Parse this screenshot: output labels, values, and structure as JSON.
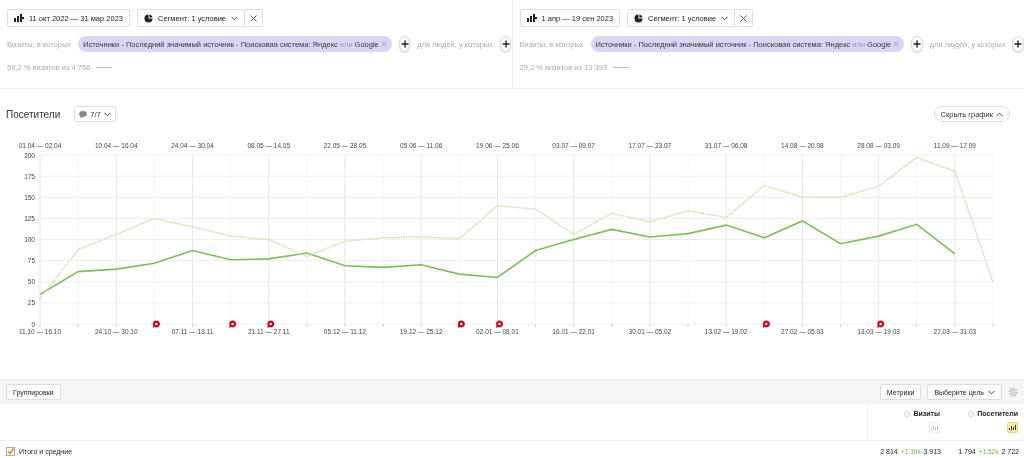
{
  "segments": [
    {
      "date_range": "11 окт 2022 — 31 мар 2023",
      "segment_button": "Сегмент: 1 условие",
      "condition_label": "Визиты, в которых",
      "chip": {
        "source": "Источники - Последний значимый источник - Поисковая система: Яндекс",
        "joiner": "или",
        "value": "Google"
      },
      "people_label": "для людей, у которых",
      "share": "59,2 % визитов из 4 756"
    },
    {
      "date_range": "1 апр — 19 сен 2023",
      "segment_button": "Сегмент: 1 условие",
      "condition_label": "Визиты, в которых",
      "chip": {
        "source": "Источники - Последний значимый источник - Поисковая система: Яндекс",
        "joiner": "или",
        "value": "Google"
      },
      "people_label": "для людей, у которых",
      "share": "29,2 % визитов из 13 393"
    }
  ],
  "chart_panel": {
    "title": "Посетители",
    "notes_button": "7/7",
    "hide_button": "Скрыть график",
    "top_axis_labels": [
      "01.04 — 02.04",
      "10.04 — 16.04",
      "24.04 — 30.04",
      "08.05 — 14.05",
      "22.05 — 28.05",
      "05.06 — 11.06",
      "19.06 — 25.06",
      "03.07 — 09.07",
      "17.07 — 23.07",
      "31.07 — 06.08",
      "14.08 — 20.08",
      "28.08 — 03.09",
      "11.09 — 17.09"
    ],
    "chart_data": {
      "type": "line",
      "categories": [
        "11.10 — 16.10",
        null,
        "24.10 — 30.10",
        null,
        "07.11 — 13.11",
        null,
        "21.11 — 27.11",
        null,
        "05.12 — 11.12",
        null,
        "19.12 — 25.12",
        null,
        "02.01 — 08.01",
        null,
        "16.01 — 22.01",
        null,
        "30.01 — 05.02",
        null,
        "13.02 — 19.02",
        null,
        "27.02 — 05.03",
        null,
        "13.03 — 19.03",
        null,
        "27.03 — 31.03",
        null
      ],
      "grid": true,
      "ylim": [
        0,
        200
      ],
      "yticks": [
        0,
        25,
        50,
        75,
        100,
        125,
        150,
        175,
        200
      ],
      "series": [
        {
          "color": "#7cbf5a",
          "line_style": "solid",
          "values": [
            35,
            62,
            65,
            72,
            87,
            76,
            77,
            84,
            69,
            67,
            70,
            59,
            55,
            87,
            100,
            112,
            103,
            107,
            117,
            102,
            122,
            95,
            104,
            118,
            83,
            null
          ]
        },
        {
          "color": "#c5e0ad",
          "line_style": "dotted",
          "values": [
            30,
            88,
            106,
            125,
            115,
            104,
            100,
            80,
            98,
            102,
            103,
            101,
            140,
            136,
            106,
            131,
            121,
            134,
            126,
            164,
            150,
            150,
            163,
            197,
            181,
            50
          ]
        }
      ]
    },
    "comment_markers": [
      false,
      false,
      false,
      true,
      false,
      true,
      true,
      false,
      false,
      false,
      false,
      true,
      true,
      false,
      false,
      false,
      false,
      false,
      false,
      true,
      false,
      false,
      true,
      false,
      false,
      false
    ]
  },
  "toolbar": {
    "groupings_button": "Группировки",
    "metrics_button": "Метрики",
    "goal_select": "Выберите цель"
  },
  "table": {
    "columns": [
      {
        "label": "Визиты",
        "selected": false
      },
      {
        "label": "Посетители",
        "selected": true
      }
    ],
    "rows": [
      {
        "label": "Итого и средние",
        "checked": true,
        "cells": [
          {
            "value": "2 814",
            "change": "+1.39x",
            "compare": "3 913"
          },
          {
            "value": "1 794",
            "change": "+1.52x",
            "compare": "2 722"
          }
        ]
      }
    ]
  }
}
